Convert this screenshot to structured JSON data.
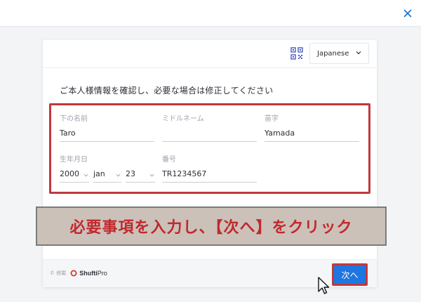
{
  "header": {
    "close_icon": "close-icon"
  },
  "card": {
    "language": "Japanese",
    "instruction": "ご本人様情報を確認し、必要な場合は修正してください",
    "fields": {
      "first_name": {
        "label": "下の名前",
        "value": "Taro"
      },
      "middle_name": {
        "label": "ミドルネーム",
        "value": ""
      },
      "last_name": {
        "label": "苗字",
        "value": "Yamada"
      },
      "dob": {
        "label": "生年月日",
        "year": "2000",
        "month": "jan",
        "day": "23"
      },
      "number": {
        "label": "番号",
        "value": "TR1234567"
      }
    }
  },
  "banner": {
    "text": "必要事項を入力し、【次へ】をクリック"
  },
  "footer": {
    "powered_by": "© 搭載",
    "brand_bold": "Shufti",
    "brand_light": "Pro",
    "next_label": "次へ"
  },
  "colors": {
    "accent": "#1f76e0",
    "highlight": "#c0393d",
    "banner_bg": "#cbc1b9",
    "close": "#1a73c8"
  }
}
